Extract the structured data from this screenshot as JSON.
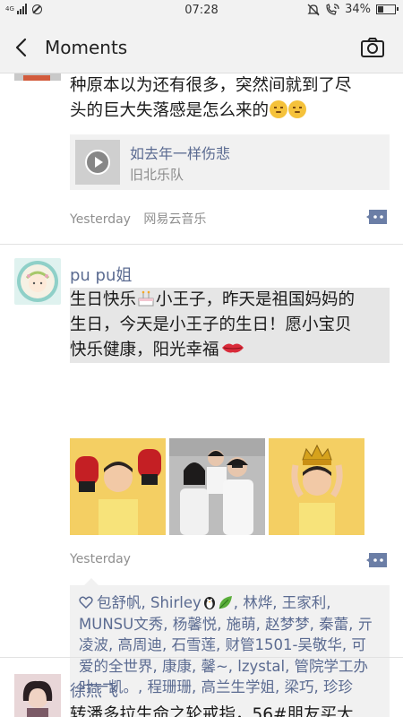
{
  "status_bar": {
    "network": "4G",
    "network_sub": "4G",
    "time": "07:28",
    "battery": "34%",
    "battery_level": 0.34
  },
  "nav": {
    "title": "Moments"
  },
  "post1": {
    "text_partial_line": "大",
    "text": "种原本以为还有很多，突然间就到了尽头的巨大失落感是怎么来的",
    "text_line1": "种原本以为还有很多，突然间就到了尽",
    "text_line2": "头的巨大失落感是怎么来的",
    "music_title": "如去年一样伤悲",
    "music_artist": "旧北乐队",
    "time": "Yesterday",
    "source": "网易云音乐"
  },
  "post2": {
    "author": "pu pu姐",
    "text_line1a": "生日快乐",
    "text_line1b": "小王子，昨天是祖国妈妈的",
    "text_line2": "生日，今天是小王子的生日！愿小宝贝",
    "text_line3": "快乐健康，阳光幸福",
    "time": "Yesterday",
    "likes": "包舒帆, Shirley",
    "likes_rest": ", 林烨, 王家利, MUNSU文秀, 杨馨悦, 施萌, 赵梦梦, 秦蕾, 亓凌波, 高周迪, 石雪莲, 财管1501-吴敬华, 可爱的全世界, 康康, 馨~, lzystal, 管院学工办叶一凯。, 程珊珊, 高兰生学姐, 梁巧, 珍珍"
  },
  "post3": {
    "author": "徐燕飞",
    "text": "转潘多拉生命之轮戒指，56#朋友买大"
  },
  "colors": {
    "link": "#5b6b91",
    "bar_bg": "#f2f2f2",
    "card_bg": "#f1f1f1"
  }
}
